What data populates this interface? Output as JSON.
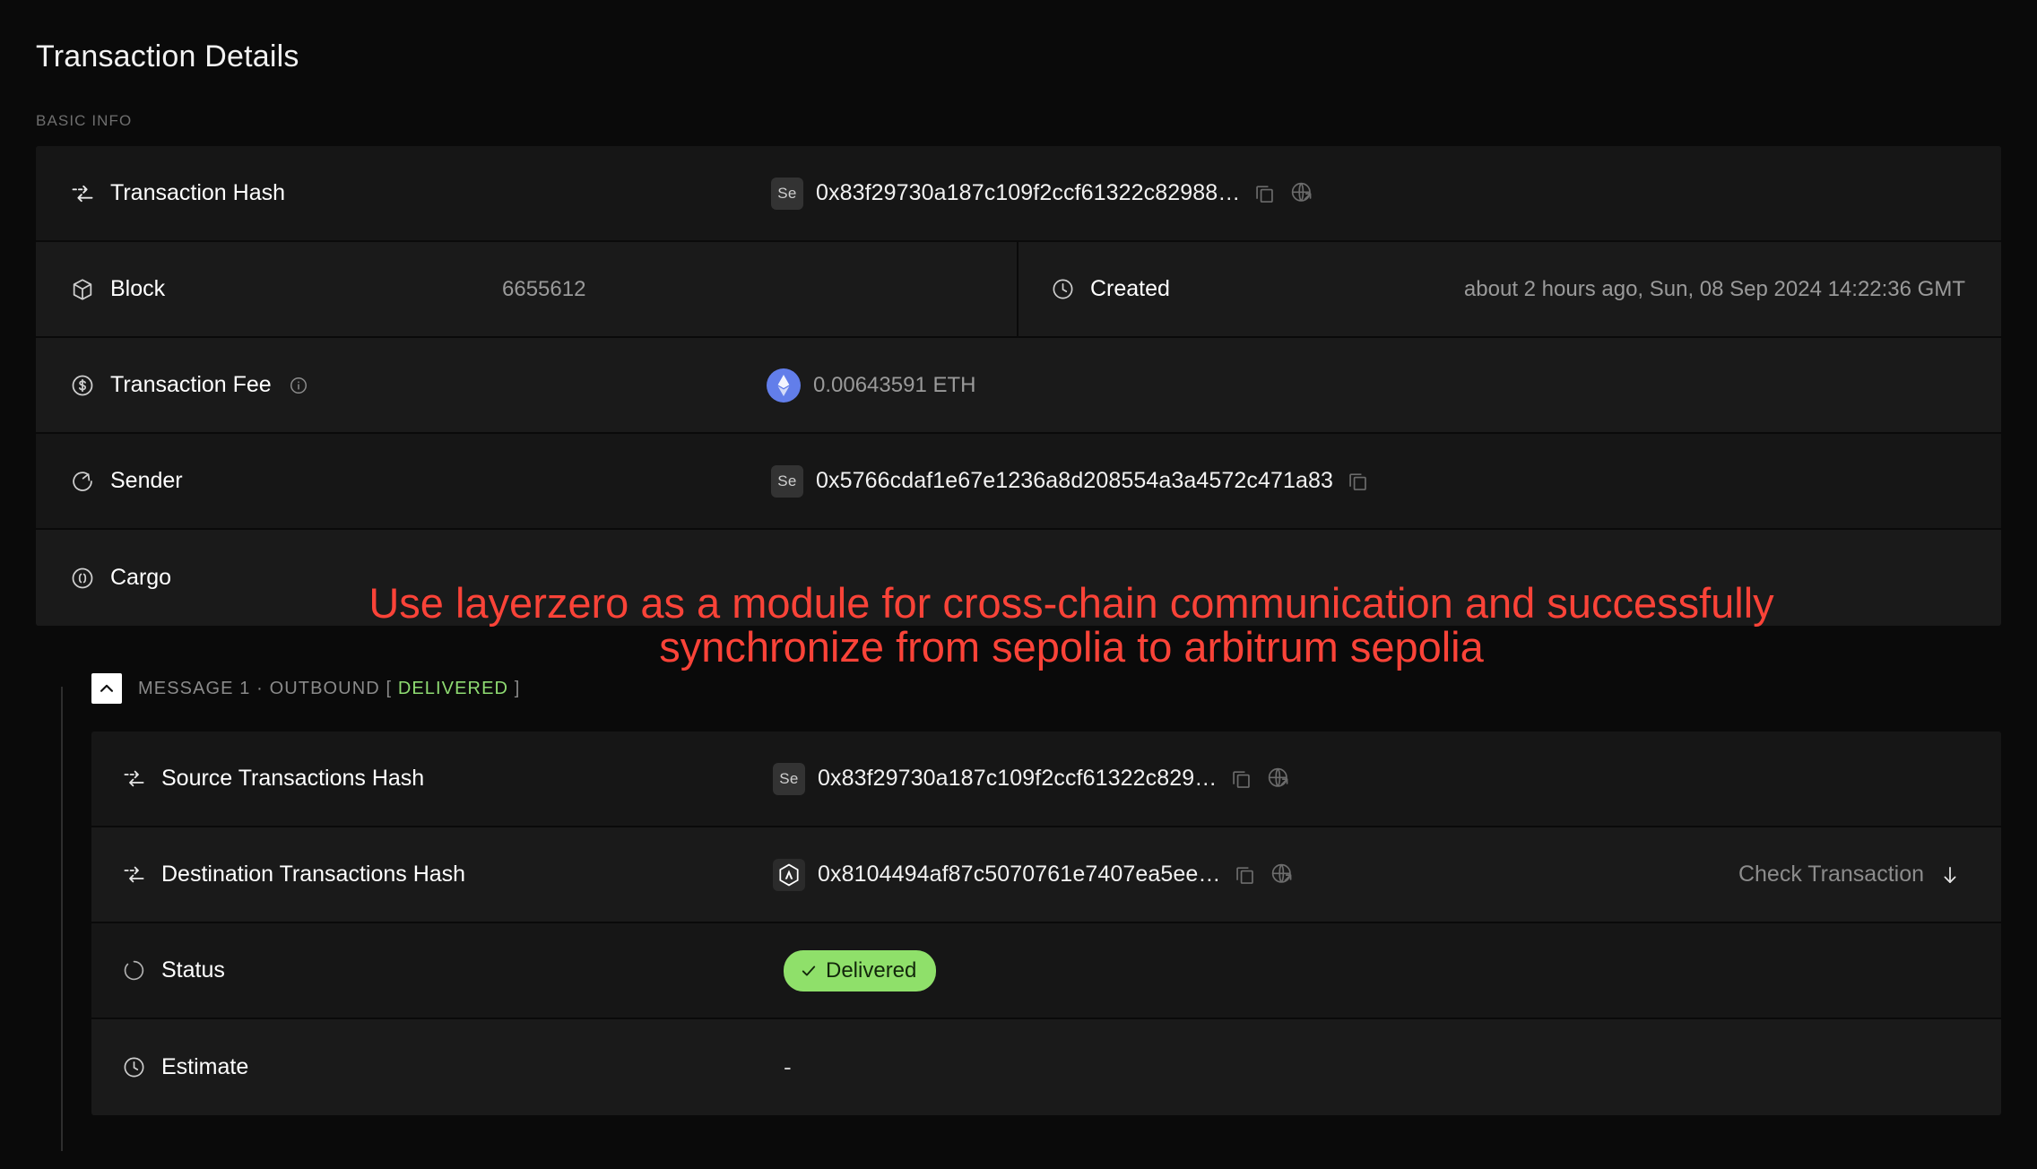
{
  "header": {
    "title": "Transaction Details"
  },
  "basic_info": {
    "section_label": "BASIC INFO",
    "rows": {
      "tx_hash": {
        "label": "Transaction Hash",
        "chain_badge": "Se",
        "value": "0x83f29730a187c109f2ccf61322c82988…",
        "copy_icon": "copy-icon",
        "explorer_icon": "globe-external-link-icon"
      },
      "block": {
        "label": "Block",
        "value": "6655612"
      },
      "created": {
        "label": "Created",
        "value": "about 2 hours ago, Sun, 08 Sep 2024 14:22:36 GMT"
      },
      "fee": {
        "label": "Transaction Fee",
        "info_icon": "info-icon",
        "value": "0.00643591 ETH",
        "coin_icon": "ethereum-icon"
      },
      "sender": {
        "label": "Sender",
        "chain_badge": "Se",
        "value": "0x5766cdaf1e67e1236a8d208554a3a4572c471a83",
        "copy_icon": "copy-icon"
      },
      "cargo": {
        "label": "Cargo"
      }
    }
  },
  "annotation": {
    "line1": "Use layerzero as a module for cross-chain communication and successfully",
    "line2": "synchronize from sepolia to arbitrum sepolia",
    "color": "#fa4338"
  },
  "message": {
    "header_prefix": "MESSAGE 1 · OUTBOUND [",
    "header_status": "DELIVERED",
    "header_suffix": "]",
    "status_color": "#8fdc72",
    "rows": {
      "source_hash": {
        "label": "Source Transactions Hash",
        "chain_badge": "Se",
        "value": "0x83f29730a187c109f2ccf61322c829…"
      },
      "dest_hash": {
        "label": "Destination Transactions Hash",
        "chain_badge": "arbitrum-icon",
        "value": "0x8104494af87c5070761e7407ea5ee…",
        "check_label": "Check Transaction"
      },
      "status": {
        "label": "Status",
        "badge": "Delivered",
        "badge_color": "#8fe06a"
      },
      "estimate": {
        "label": "Estimate",
        "value": "-"
      }
    }
  }
}
